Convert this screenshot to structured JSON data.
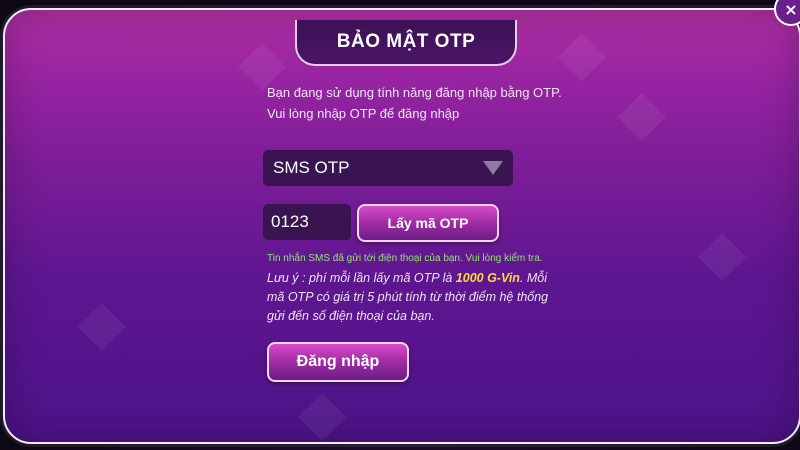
{
  "dialog": {
    "title": "BẢO MẬT OTP",
    "close_symbol": "×",
    "info_line1": "Bạn đang sử dụng tính năng đăng nhập bằng OTP.",
    "info_line2": "Vui lòng nhập OTP để đăng nhập",
    "otp_type": {
      "selected": "SMS OTP"
    },
    "otp_code": {
      "value": "0123"
    },
    "get_otp_button": "Lấy mã OTP",
    "sms_sent_notice": "Tin nhắn SMS đã gửi tới điện thoại của bạn. Vui lòng kiểm tra.",
    "note": {
      "prefix": "Lưu ý : phí mỗi lần lấy mã OTP là ",
      "fee": "1000 G-Vin",
      "suffix": ". Mỗi mã OTP có giá trị 5 phút tính từ thời điểm hệ thống gửi đến số điện thoại của bạn."
    },
    "login_button": "Đăng nhập"
  },
  "colors": {
    "accent": "#ffd93b",
    "success": "#8ee86a",
    "panel_top": "#b02fa2",
    "panel_bottom": "#4d1388"
  },
  "icons": {
    "close": "close-icon",
    "dropdown": "chevron-down-icon"
  }
}
